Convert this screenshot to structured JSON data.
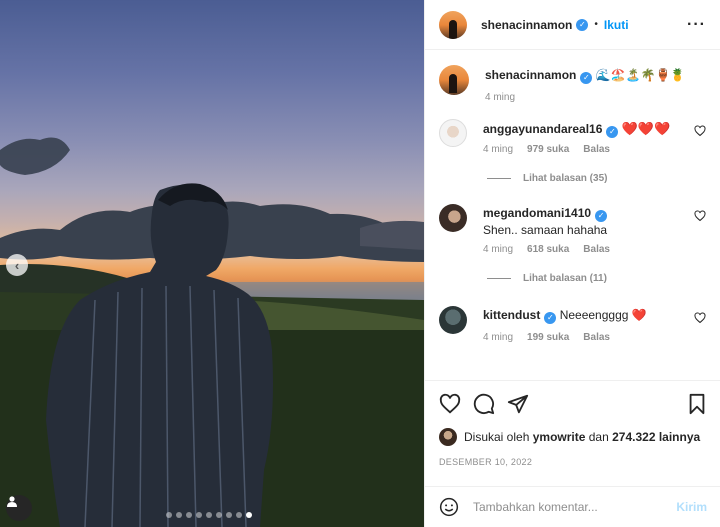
{
  "post": {
    "image_alt_subject": "man-silhouette-sunset",
    "carousel_total": 9,
    "carousel_active": 9
  },
  "header": {
    "username": "shenacinnamon",
    "separator": "•",
    "follow_label": "Ikuti",
    "more_label": "···"
  },
  "caption": {
    "username": "shenacinnamon",
    "text": "🌊🏖️🏝️🌴🏺🍍",
    "time": "4 ming"
  },
  "comments": [
    {
      "username": "anggayunandareal16",
      "text": "❤️❤️❤️",
      "time": "4 ming",
      "likes": "979 suka",
      "reply": "Balas",
      "view_replies": "Lihat balasan (35)"
    },
    {
      "username": "megandomani1410",
      "text": "Shen.. samaan hahaha",
      "time": "4 ming",
      "likes": "618 suka",
      "reply": "Balas",
      "view_replies": "Lihat balasan (11)"
    },
    {
      "username": "kittendust",
      "text": "Neeeengggg ❤️",
      "time": "4 ming",
      "likes": "199 suka",
      "reply": "Balas"
    }
  ],
  "likes": {
    "prefix": "Disukai oleh",
    "user": "ymowrite",
    "middle": "dan",
    "count": "274.322 lainnya"
  },
  "date": "DESEMBER 10, 2022",
  "comment_input": {
    "placeholder": "Tambahkan komentar...",
    "send_label": "Kirim"
  },
  "colors": {
    "link": "#0095f6",
    "verified": "#3897f0",
    "muted": "#8e8e8e",
    "heart": "#ed4956"
  }
}
